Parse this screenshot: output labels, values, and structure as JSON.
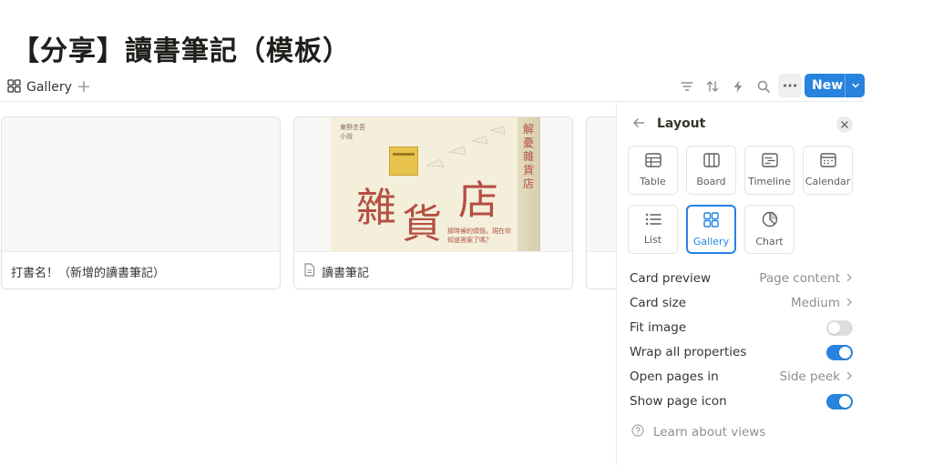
{
  "page": {
    "title": "【分享】讀書筆記（模板）"
  },
  "view_bar": {
    "active_view": "Gallery",
    "add_view_icon": "plus-icon"
  },
  "toolbar": {
    "icons": [
      "filter-icon",
      "sort-icon",
      "lightning-icon",
      "search-icon",
      "more-icon"
    ],
    "new_label": "New"
  },
  "gallery": {
    "cards": [
      {
        "title": "打書名！（新增的讀書筆記）",
        "has_icon": false,
        "cover": "empty"
      },
      {
        "title": "讀書筆記",
        "has_icon": true,
        "icon": "page-icon",
        "cover": "book"
      }
    ],
    "book_cover": {
      "title_chars": [
        "雜",
        "貨",
        "店"
      ],
      "spine_text": "解憂雜貨店",
      "blurb": "那時候的煩惱，現在你知道答案了嗎？",
      "top_lines": [
        "東野圭吾",
        "小說"
      ]
    }
  },
  "layout_panel": {
    "title": "Layout",
    "layouts": [
      {
        "label": "Table",
        "icon": "table-icon",
        "active": false
      },
      {
        "label": "Board",
        "icon": "board-icon",
        "active": false
      },
      {
        "label": "Timeline",
        "icon": "timeline-icon",
        "active": false
      },
      {
        "label": "Calendar",
        "icon": "calendar-icon",
        "active": false
      },
      {
        "label": "List",
        "icon": "list-icon",
        "active": false
      },
      {
        "label": "Gallery",
        "icon": "gallery-icon",
        "active": true
      },
      {
        "label": "Chart",
        "icon": "chart-icon",
        "active": false
      }
    ],
    "properties": [
      {
        "label": "Card preview",
        "value": "Page content",
        "type": "select"
      },
      {
        "label": "Card size",
        "value": "Medium",
        "type": "select"
      },
      {
        "label": "Fit image",
        "type": "toggle",
        "on": false
      },
      {
        "label": "Wrap all properties",
        "type": "toggle",
        "on": true
      },
      {
        "label": "Open pages in",
        "value": "Side peek",
        "type": "select"
      },
      {
        "label": "Show page icon",
        "type": "toggle",
        "on": true
      }
    ],
    "learn_label": "Learn about views"
  },
  "colors": {
    "accent": "#2783de",
    "text": "#37352f",
    "muted": "#8f8e8a",
    "border": "#e9e9e7"
  }
}
